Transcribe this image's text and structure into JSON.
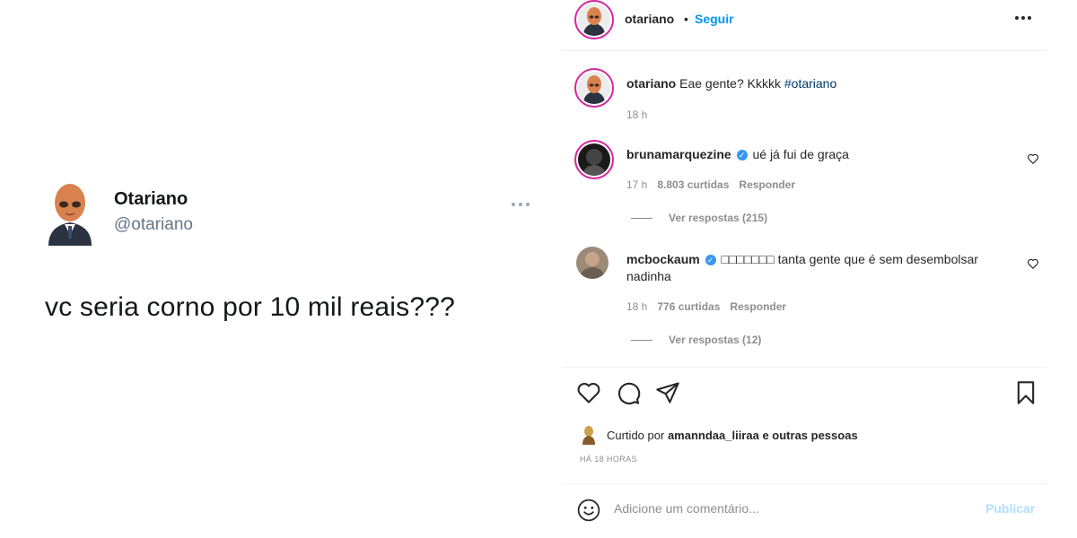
{
  "tweet": {
    "name": "Otariano",
    "handle": "@otariano",
    "text": "vc seria corno por 10 mil reais???",
    "more_icon": "more-horizontal-icon"
  },
  "instagram": {
    "header": {
      "username": "otariano",
      "separator": "•",
      "follow_label": "Seguir"
    },
    "caption": {
      "username": "otariano",
      "text": "Eae gente? Kkkkk",
      "hashtag": "#otariano",
      "time": "18 h"
    },
    "comments": [
      {
        "username": "bruna marquezine",
        "username_display": "brunamarquezine",
        "verified": true,
        "text": "ué já fui de graça",
        "time": "17 h",
        "likes": "8.803 curtidas",
        "reply_label": "Responder",
        "view_replies": "Ver respostas (215)"
      },
      {
        "username_display": "mcbockaum",
        "verified": true,
        "text": "□□□□□□□ tanta gente que é sem desembolsar nadinha",
        "time": "18 h",
        "likes": "776 curtidas",
        "reply_label": "Responder",
        "view_replies": "Ver respostas (12)"
      }
    ],
    "liked_by": {
      "prefix": "Curtido por",
      "user": "amanndaa_liiraa",
      "suffix": "e outras pessoas"
    },
    "post_time": "HÁ 18 HORAS",
    "comment_placeholder": "Adicione um comentário...",
    "publish_label": "Publicar",
    "colors": {
      "link_blue": "#0095f6",
      "hashtag": "#00376b",
      "muted": "#8e8e8e",
      "publish_disabled": "#b2dffc"
    }
  }
}
